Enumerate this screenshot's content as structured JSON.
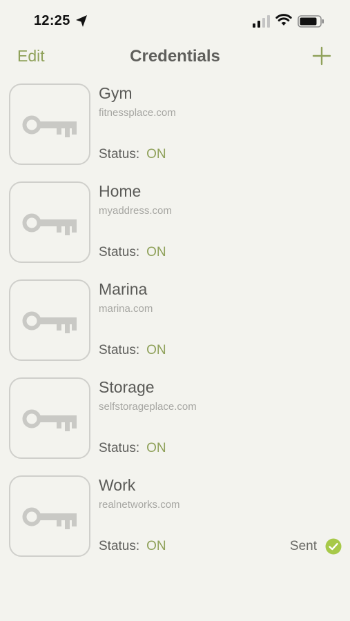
{
  "status_bar": {
    "time": "12:25",
    "location_icon": "location-arrow-icon",
    "signal_icon": "cellular-signal-icon",
    "wifi_icon": "wifi-icon",
    "battery_icon": "battery-icon"
  },
  "nav": {
    "edit_label": "Edit",
    "title": "Credentials",
    "add_icon": "plus-icon"
  },
  "colors": {
    "accent": "#8fa15a",
    "background": "#f3f3ee",
    "sent_check": "#a7c949"
  },
  "credentials": [
    {
      "name": "Gym",
      "url": "fitnessplace.com",
      "status_label": "Status:",
      "status": "ON"
    },
    {
      "name": "Home",
      "url": "myaddress.com",
      "status_label": "Status:",
      "status": "ON"
    },
    {
      "name": "Marina",
      "url": "marina.com",
      "status_label": "Status:",
      "status": "ON"
    },
    {
      "name": "Storage",
      "url": "selfstorageplace.com",
      "status_label": "Status:",
      "status": "ON"
    },
    {
      "name": "Work",
      "url": "realnetworks.com",
      "status_label": "Status:",
      "status": "ON",
      "sent_label": "Sent"
    }
  ]
}
